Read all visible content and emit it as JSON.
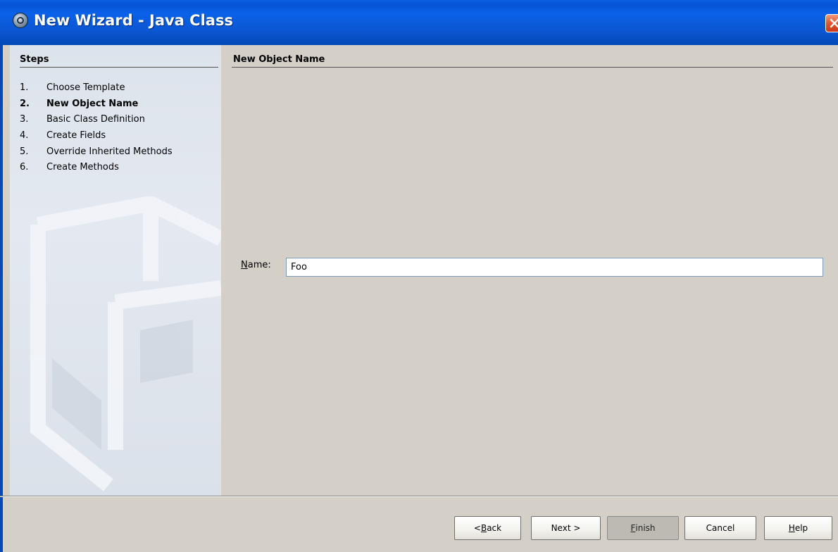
{
  "window": {
    "title": "New Wizard - Java Class"
  },
  "icons": {
    "app_icon": "netbeans-icon",
    "close_icon": "close-icon"
  },
  "colors": {
    "titlebar": "#0a5fe0",
    "close_button": "#e0552c",
    "panel_bg": "#d4d0c8",
    "steps_bg": "#dde3ec"
  },
  "steps": {
    "title": "Steps",
    "items": [
      {
        "num": "1.",
        "label": "Choose Template"
      },
      {
        "num": "2.",
        "label": "New Object Name"
      },
      {
        "num": "3.",
        "label": "Basic Class Definition"
      },
      {
        "num": "4.",
        "label": "Create Fields"
      },
      {
        "num": "5.",
        "label": "Override Inherited Methods"
      },
      {
        "num": "6.",
        "label": "Create Methods"
      }
    ],
    "active_index": 1
  },
  "main": {
    "title": "New Object Name",
    "name_label_mnemonic": "N",
    "name_label_rest": "ame:",
    "name_value": "Foo"
  },
  "buttons": {
    "back": {
      "prefix": "< ",
      "mnemonic": "B",
      "rest": "ack"
    },
    "next": {
      "label": "Next >"
    },
    "finish": {
      "mnemonic": "F",
      "rest": "inish",
      "enabled": false
    },
    "cancel": {
      "label": "Cancel"
    },
    "help": {
      "mnemonic": "H",
      "rest": "elp"
    }
  }
}
